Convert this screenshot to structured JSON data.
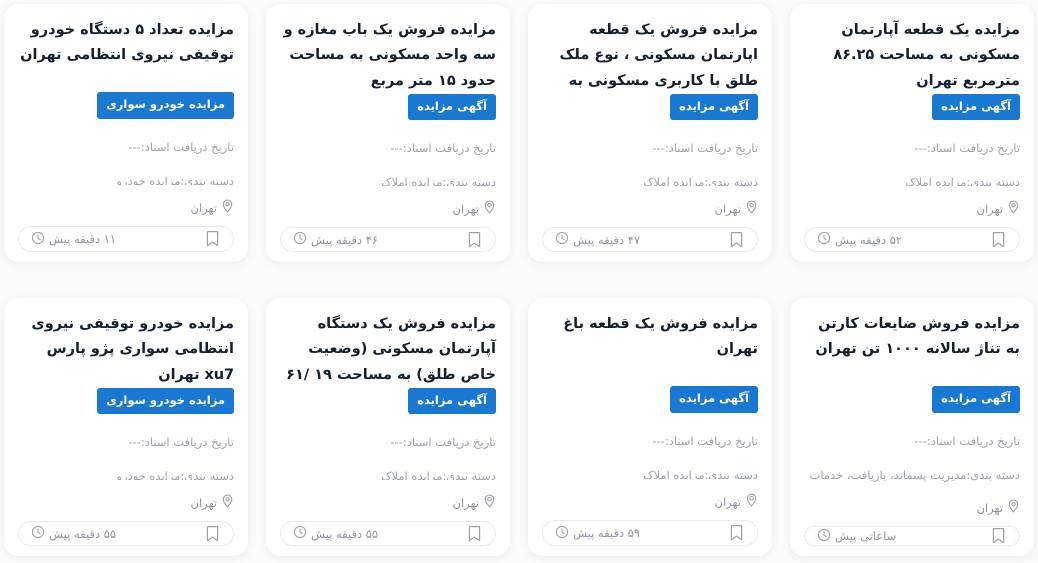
{
  "colors": {
    "badge_bg": "#1878d2",
    "badge_text": "#ffffff",
    "card_bg": "#ffffff",
    "page_bg": "#fbfbfc",
    "title_text": "#14202e",
    "meta_text": "#9aa2ad"
  },
  "icons": {
    "pin": "location-pin-icon",
    "clock": "clock-icon",
    "bookmark": "bookmark-icon"
  },
  "cards": [
    {
      "title": "مزایده یک قطعه آپارتمان مسکونی به مساحت ۸۶.۲۵ مترمربع تهران",
      "badge": "آگهی مزایده",
      "docs_date": "تاریخ دریافت اسناد:---",
      "category": "دسته بندی:مزایده املاک",
      "location": "تهران",
      "time_ago": "۵۲ دقیقه پیش"
    },
    {
      "title": "مزایده فروش یک قطعه اپارتمان مسکونی ، نوع ملک طلق با کاربری مسکونی به",
      "badge": "آگهی مزایده",
      "docs_date": "تاریخ دریافت اسناد:---",
      "category": "دسته بندی:مزایده املاک",
      "location": "تهران",
      "time_ago": "۴۷ دقیقه پیش"
    },
    {
      "title": "مزایده فروش یک باب مغازه و سه واحد مسکونی به مساحت حدود ۱۵ متر مربع",
      "badge": "آگهی مزایده",
      "docs_date": "تاریخ دریافت اسناد:---",
      "category": "دسته بندی:مزایده املاک",
      "location": "تهران",
      "time_ago": "۴۶ دقیقه پیش"
    },
    {
      "title": "مزایده تعداد ۵ دستگاه خودرو توقیفی نیروی انتظامی تهران",
      "badge": "مزایده خودرو سواری",
      "docs_date": "تاریخ دریافت اسناد:---",
      "category": "دسته بندی:مزایده خودرو",
      "location": "تهران",
      "time_ago": "۱۱ دقیقه پیش"
    },
    {
      "title": "مزایده فروش ضایعات کارتن به تناژ سالانه ۱۰۰۰ تن تهران",
      "badge": "آگهی مزایده",
      "docs_date": "تاریخ دریافت اسناد:---",
      "category": "دسته بندی:مدیریت پسماند، بازیافت، خدمات شهری و",
      "location": "تهران",
      "time_ago": "ساعاتی پیش"
    },
    {
      "title": "مزایده فروش یک قطعه باغ تهران",
      "badge": "آگهی مزایده",
      "docs_date": "تاریخ دریافت اسناد:---",
      "category": "دسته بندی:مزایده املاک",
      "location": "تهران",
      "time_ago": "۵۹ دقیقه پیش"
    },
    {
      "title": "مزایده فروش یک دستگاه آپارتمان مسکونی (وضعیت خاص طلق) به مساحت ۱۹ /۶۱",
      "badge": "آگهی مزایده",
      "docs_date": "تاریخ دریافت اسناد:---",
      "category": "دسته بندی:مزایده املاک",
      "location": "تهران",
      "time_ago": "۵۵ دقیقه پیش"
    },
    {
      "title": "مزایده خودرو توقیفی نیروی انتظامی سواری پژو پارس xu7 تهران",
      "badge": "مزایده خودرو سواری",
      "docs_date": "تاریخ دریافت اسناد:---",
      "category": "دسته بندی:مزایده خودرو",
      "location": "تهران",
      "time_ago": "۵۵ دقیقه پیش"
    }
  ]
}
